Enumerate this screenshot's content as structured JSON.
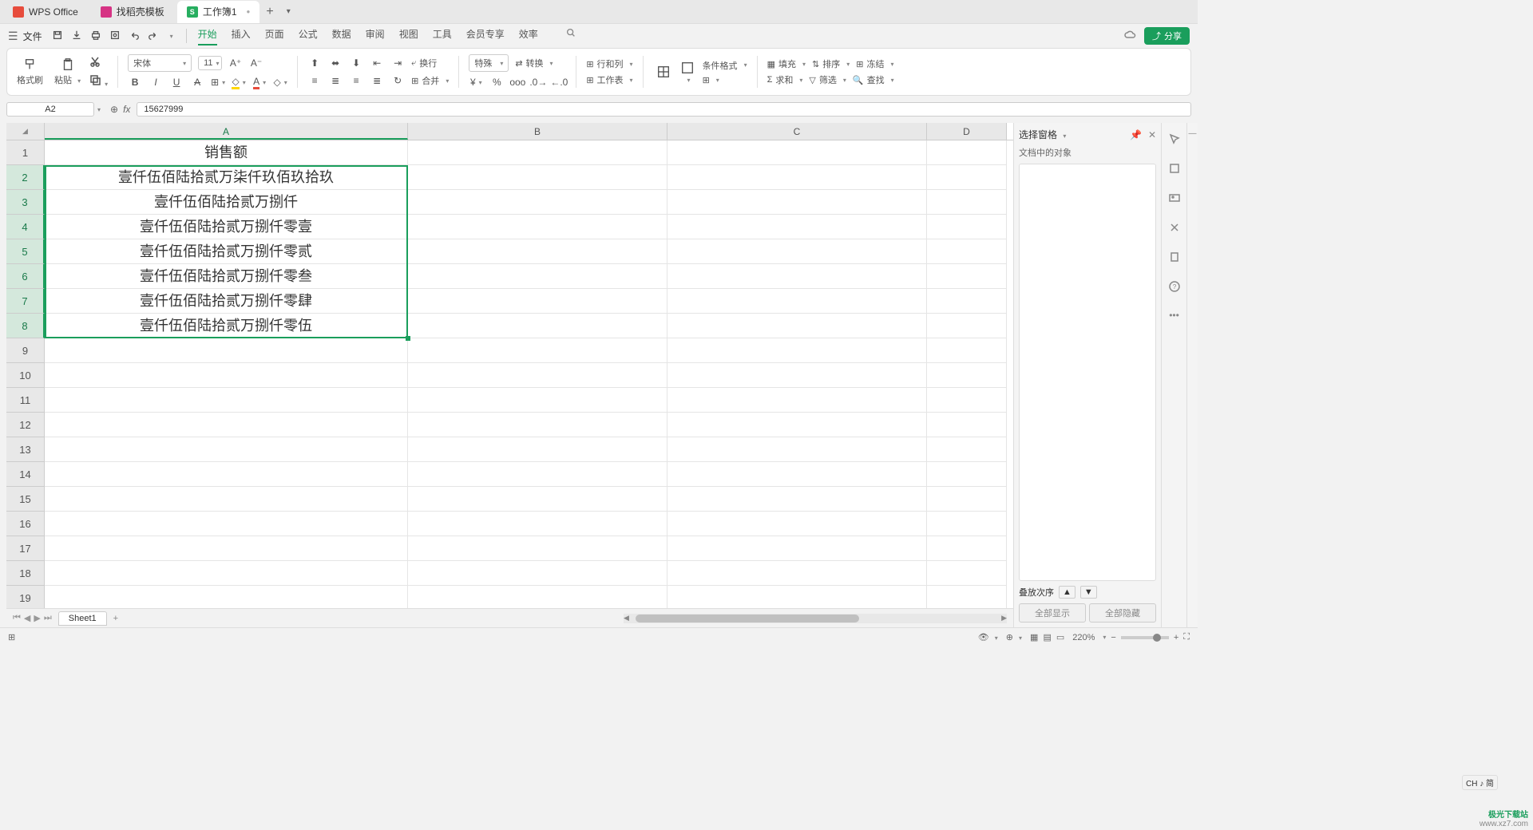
{
  "titlebar": {
    "tabs": [
      {
        "label": "WPS Office"
      },
      {
        "label": "找稻壳模板"
      },
      {
        "label": "工作簿1"
      }
    ]
  },
  "menubar": {
    "file": "文件",
    "tabs": [
      "开始",
      "插入",
      "页面",
      "公式",
      "数据",
      "审阅",
      "视图",
      "工具",
      "会员专享",
      "效率"
    ],
    "active": 0,
    "share": "分享"
  },
  "ribbon": {
    "formatPainter": "格式刷",
    "paste": "粘贴",
    "fontName": "宋体",
    "fontSize": "11",
    "wrap": "换行",
    "merge": "合并",
    "numberFormat": "特殊",
    "convert": "转换",
    "rowsCols": "行和列",
    "worksheet": "工作表",
    "condFormat": "条件格式",
    "fill": "填充",
    "sort": "排序",
    "freeze": "冻结",
    "sum": "求和",
    "filter": "筛选",
    "find": "查找"
  },
  "namebox": "A2",
  "formula": "15627999",
  "columns": [
    "A",
    "B",
    "C",
    "D"
  ],
  "rows": [
    "1",
    "2",
    "3",
    "4",
    "5",
    "6",
    "7",
    "8",
    "9",
    "10",
    "11",
    "12",
    "13",
    "14",
    "15",
    "16",
    "17",
    "18",
    "19"
  ],
  "cells": {
    "A1": "销售额",
    "A2": "壹仟伍佰陆拾贰万柒仟玖佰玖拾玖",
    "A3": "壹仟伍佰陆拾贰万捌仟",
    "A4": "壹仟伍佰陆拾贰万捌仟零壹",
    "A5": "壹仟伍佰陆拾贰万捌仟零贰",
    "A6": "壹仟伍佰陆拾贰万捌仟零叁",
    "A7": "壹仟伍佰陆拾贰万捌仟零肆",
    "A8": "壹仟伍佰陆拾贰万捌仟零伍"
  },
  "sheet": {
    "name": "Sheet1"
  },
  "sidepanel": {
    "title": "选择窗格",
    "subtitle": "文档中的对象",
    "order": "叠放次序",
    "showAll": "全部显示",
    "hideAll": "全部隐藏"
  },
  "status": {
    "zoom": "220%",
    "ch": "CH ♪ 简"
  },
  "watermark": {
    "line1": "极光下载站",
    "line2": "www.xz7.com"
  }
}
